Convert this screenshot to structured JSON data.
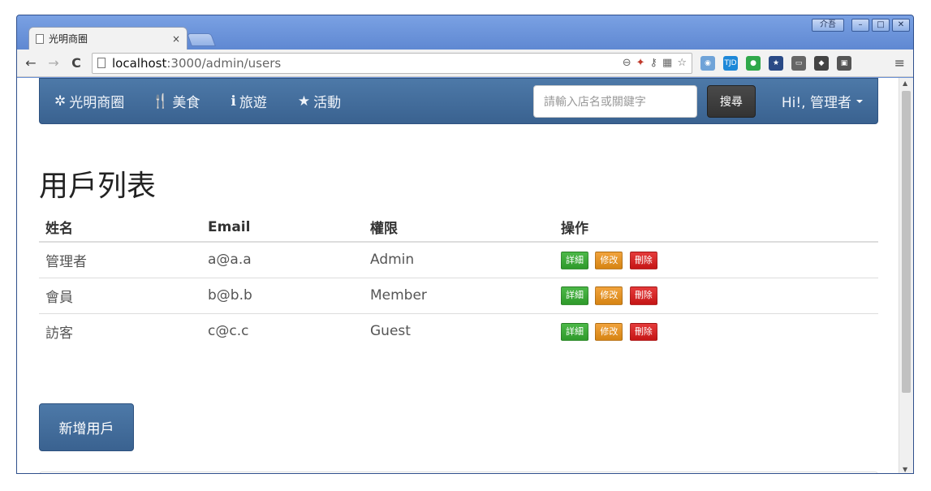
{
  "window": {
    "ime_label": "介吾",
    "controls": [
      "–",
      "□",
      "✕"
    ]
  },
  "tab": {
    "title": "光明商圈",
    "close": "×"
  },
  "browser": {
    "back": "←",
    "forward": "→",
    "reload": "C",
    "url_host": "localhost",
    "url_path": ":3000/admin/users",
    "menu": "≡",
    "omnibox_icons": [
      "zoom-icon",
      "fire-icon",
      "key-icon",
      "translate-icon",
      "star-icon"
    ],
    "extensions": [
      {
        "name": "camera-extension-icon",
        "color": "#6fa3d8",
        "glyph": "◉"
      },
      {
        "name": "tjd-extension-icon",
        "color": "#1e88d8",
        "glyph": "TJD"
      },
      {
        "name": "leaf-extension-icon",
        "color": "#2fa84a",
        "glyph": "●"
      },
      {
        "name": "bookmark-extension-icon",
        "color": "#2a4a86",
        "glyph": "★"
      },
      {
        "name": "cast-extension-icon",
        "color": "#666666",
        "glyph": "▭"
      },
      {
        "name": "octocat-extension-icon",
        "color": "#444444",
        "glyph": "◆"
      },
      {
        "name": "pocket-extension-icon",
        "color": "#555555",
        "glyph": "▣"
      }
    ]
  },
  "navbar": {
    "brand": "光明商圈",
    "links": [
      {
        "label": "美食",
        "icon": "utensils-icon"
      },
      {
        "label": "旅遊",
        "icon": "info-icon"
      },
      {
        "label": "活動",
        "icon": "star-icon"
      }
    ],
    "search_placeholder": "請輸入店名或關鍵字",
    "search_button": "搜尋",
    "user_greeting": "Hi!, 管理者"
  },
  "page": {
    "title": "用戶列表",
    "table": {
      "headers": [
        "姓名",
        "Email",
        "權限",
        "操作"
      ],
      "rows": [
        {
          "name": "管理者",
          "email": "a@a.a",
          "role": "Admin"
        },
        {
          "name": "會員",
          "email": "b@b.b",
          "role": "Member"
        },
        {
          "name": "訪客",
          "email": "c@c.c",
          "role": "Guest"
        }
      ],
      "actions": {
        "detail": "詳細",
        "edit": "修改",
        "delete": "刪除"
      }
    },
    "add_button": "新增用戶"
  },
  "colors": {
    "navbar": "#3f6a99",
    "detail": "#3aa836",
    "edit": "#e3921f",
    "delete": "#d42424"
  }
}
